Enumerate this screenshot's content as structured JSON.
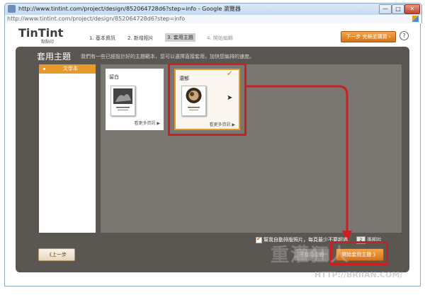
{
  "window": {
    "title": "http://www.tintint.com/project/design/852064728d6?step=info - Google 瀏覽器",
    "url": "http://www.tintint.com/project/design/852064728d6?step=info",
    "minimize_label": "—",
    "maximize_label": "□",
    "close_label": "✕"
  },
  "header": {
    "logo": "TinTint",
    "logo_sub": "點點印",
    "steps": [
      {
        "label": "1. 基本資訊",
        "state": "done"
      },
      {
        "label": "2. 新增相片",
        "state": "done"
      },
      {
        "label": "3. 套用主題",
        "state": "active"
      },
      {
        "label": "4. 開始編輯",
        "state": "upcoming"
      }
    ],
    "next_button": "下一步 完稿並購買 ›",
    "help_label": "?"
  },
  "panel": {
    "title": "套用主題",
    "description": "我們有一些已經設計好的主題範本，您可以選擇直接套用，加快您編排的速度。"
  },
  "sidebar": {
    "items": [
      {
        "label": "文學本",
        "selected": true
      }
    ]
  },
  "themes": [
    {
      "name": "留白",
      "more": "看更多資訊 ▶",
      "selected": false
    },
    {
      "name": "濃郁",
      "more": "看更多資訊 ▶",
      "selected": true
    }
  ],
  "footer": {
    "auto_arrange": "幫我自動排版照片，每頁最少不要超過",
    "per_page_suffix": "張相片",
    "count": "2",
    "prev_button": "《上一步",
    "no_theme_button": "不套用主題",
    "apply_button": "開始套用主題 》"
  },
  "watermark": {
    "text": "重灌狂人",
    "url": "HTTP://BRIIAN.COM/"
  },
  "colors": {
    "accent": "#e69a2a",
    "annotation": "#cc1f1f",
    "panel": "#5a5652"
  }
}
